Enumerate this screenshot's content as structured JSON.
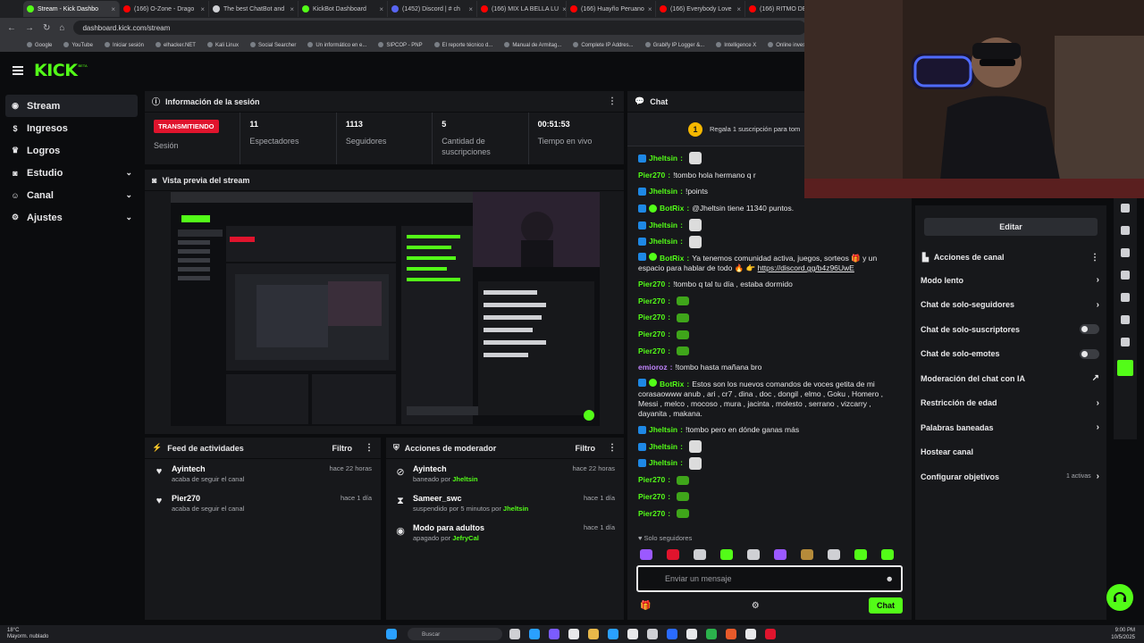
{
  "browser": {
    "tabs": [
      {
        "label": "Stream - Kick Dashbo",
        "color": "#53fc18",
        "active": true
      },
      {
        "label": "(166) O-Zone - Drago",
        "color": "#ff0000"
      },
      {
        "label": "The best ChatBot and",
        "color": "#cfd0d4"
      },
      {
        "label": "KickBot Dashboard",
        "color": "#53fc18"
      },
      {
        "label": "(1452) Discord | # ch",
        "color": "#5865f2"
      },
      {
        "label": "(166) MIX LA BELLA LU",
        "color": "#ff0000"
      },
      {
        "label": "(166) Huayño Peruano",
        "color": "#ff0000"
      },
      {
        "label": "(166) Everybody Love",
        "color": "#ff0000"
      },
      {
        "label": "(166) RITMO DE MI TI",
        "color": "#ff0000"
      }
    ],
    "url": "dashboard.kick.com/stream",
    "bookmarks": [
      "Google",
      "YouTube",
      "Iniciar sesión",
      "elhacker.NET",
      "Kali Linux",
      "Social Searcher",
      "Un informático en e...",
      "SIPCOP - PNP",
      "El reporte técnico d...",
      "Manual de Armitag...",
      "Complete IP Addres...",
      "Grabify IP Logger &...",
      "Intelligence X",
      "Online investigation..."
    ]
  },
  "header": {
    "logo": "KICK",
    "beta": "BETA"
  },
  "sidebar": {
    "items": [
      {
        "label": "Stream",
        "icon": "broadcast-icon"
      },
      {
        "label": "Ingresos",
        "icon": "money-icon"
      },
      {
        "label": "Logros",
        "icon": "trophy-icon"
      },
      {
        "label": "Estudio",
        "icon": "camera-icon"
      },
      {
        "label": "Canal",
        "icon": "user-icon"
      },
      {
        "label": "Ajustes",
        "icon": "gear-icon"
      }
    ]
  },
  "session": {
    "title": "Información de la sesión",
    "badge": "TRANSMITIENDO",
    "badge_label": "Sesión",
    "stats": [
      {
        "value": "11",
        "label": "Espectadores"
      },
      {
        "value": "1113",
        "label": "Seguidores"
      },
      {
        "value": "5",
        "label": "Cantidad de suscripciones"
      },
      {
        "value": "00:51:53",
        "label": "Tiempo en vivo"
      }
    ]
  },
  "preview": {
    "title": "Vista previa del stream"
  },
  "feed": {
    "title": "Feed de actividades",
    "filter": "Filtro",
    "items": [
      {
        "name": "Ayintech",
        "text": "acaba de seguir el canal",
        "time": "hace 22 horas"
      },
      {
        "name": "Pier270",
        "text": "acaba de seguir el canal",
        "time": "hace 1 día"
      }
    ]
  },
  "mod": {
    "title": "Acciones de moderador",
    "filter": "Filtro",
    "items": [
      {
        "name": "Ayintech",
        "text": "baneado por",
        "by": "Jheltsin",
        "time": "hace 22 horas",
        "icon": "ban-icon"
      },
      {
        "name": "Sameer_swc",
        "text": "suspendido por 5 minutos por",
        "by": "Jheltsin",
        "time": "hace 1 día",
        "icon": "hourglass-icon"
      },
      {
        "name": "Modo para adultos",
        "text": "apagado por",
        "by": "JefryCal",
        "time": "hace 1 día",
        "icon": "eye-icon"
      }
    ]
  },
  "chat": {
    "title": "Chat",
    "pinned": "Regala 1 suscripción para tom",
    "pinned_count": "1",
    "messages": [
      {
        "user": "Jheltsin",
        "color": "#53fc18",
        "text": "",
        "emote": "gh",
        "badge": "mod"
      },
      {
        "user": "Pier270",
        "color": "#53fc18",
        "text": "!tombo hola hermano q r"
      },
      {
        "user": "Jheltsin",
        "color": "#53fc18",
        "text": "!points",
        "badge": "mod"
      },
      {
        "user": "BotRix",
        "color": "#53fc18",
        "text": "@Jheltsin tiene 11340 puntos.",
        "badge": "bot"
      },
      {
        "user": "Jheltsin",
        "color": "#53fc18",
        "text": "",
        "emote": "gh",
        "badge": "mod"
      },
      {
        "user": "Jheltsin",
        "color": "#53fc18",
        "text": "",
        "emote": "gh",
        "badge": "mod"
      },
      {
        "user": "BotRix",
        "color": "#53fc18",
        "text": "Ya tenemos comunidad activa, juegos, sorteos 🎁 y un espacio para hablar de todo 🔥 👉",
        "link": "https://discord.gg/b4z96UwE",
        "badge": "bot",
        "multi": true
      },
      {
        "user": "Pier270",
        "color": "#53fc18",
        "text": "!tombo q tal tu día , estaba dormido"
      },
      {
        "user": "Pier270",
        "color": "#53fc18",
        "text": "",
        "emote": "gr"
      },
      {
        "user": "Pier270",
        "color": "#53fc18",
        "text": "",
        "emote": "gr"
      },
      {
        "user": "Pier270",
        "color": "#53fc18",
        "text": "",
        "emote": "gr"
      },
      {
        "user": "Pier270",
        "color": "#53fc18",
        "text": "",
        "emote": "gr"
      },
      {
        "user": "emioroz",
        "color": "#c084fc",
        "text": "!tombo hasta mañana bro"
      },
      {
        "user": "BotRix",
        "color": "#53fc18",
        "text": "Estos son los nuevos comandos de voces getita de mi corasaowww anub , ari , cr7 , dina , doc , dongil , elmo , Goku , Homero , Messi , melco , mocoso , mura , jacinta , molesto , serrano , vizcarry , dayanita , makana.",
        "badge": "bot",
        "multi": true
      },
      {
        "user": "Jheltsin",
        "color": "#53fc18",
        "text": "!tombo pero en dónde ganas más",
        "badge": "mod"
      },
      {
        "user": "Jheltsin",
        "color": "#53fc18",
        "text": "",
        "emote": "gh",
        "badge": "mod"
      },
      {
        "user": "Jheltsin",
        "color": "#53fc18",
        "text": "",
        "emote": "gh",
        "badge": "mod"
      },
      {
        "user": "Pier270",
        "color": "#53fc18",
        "text": "",
        "emote": "gr"
      },
      {
        "user": "Pier270",
        "color": "#53fc18",
        "text": "",
        "emote": "gr"
      },
      {
        "user": "Pier270",
        "color": "#53fc18",
        "text": "",
        "emote": "gr"
      }
    ],
    "solo": "Solo seguidores",
    "input_placeholder": "Enviar un mensaje",
    "send_label": "Chat"
  },
  "channel": {
    "edit_label": "Editar",
    "title": "Acciones de canal",
    "items": [
      {
        "label": "Modo lento",
        "control": "arrow"
      },
      {
        "label": "Chat de solo-seguidores",
        "control": "arrow"
      },
      {
        "label": "Chat de solo-suscriptores",
        "control": "toggle"
      },
      {
        "label": "Chat de solo-emotes",
        "control": "toggle"
      },
      {
        "label": "Moderación del chat con IA",
        "control": "external"
      },
      {
        "label": "Restricción de edad",
        "control": "arrow"
      },
      {
        "label": "Palabras baneadas",
        "control": "arrow"
      },
      {
        "label": "Hostear canal",
        "control": "none"
      },
      {
        "label": "Configurar objetivos",
        "control": "arrow",
        "extra": "1 activas"
      }
    ]
  },
  "taskbar": {
    "weather_temp": "18°C",
    "weather_desc": "Mayorm. nublado",
    "search": "Buscar",
    "time": "9:00 PM",
    "date": "10/5/2025"
  },
  "colors": {
    "accent": "#53fc18",
    "live": "#e0142d",
    "panel": "#17181b",
    "bg": "#0b0c0e"
  }
}
